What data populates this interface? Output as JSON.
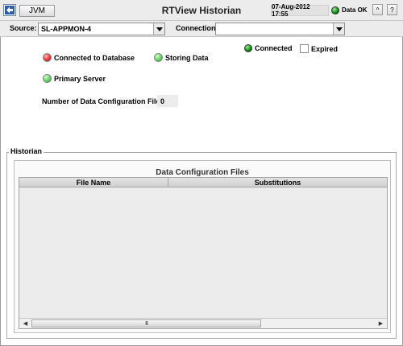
{
  "header": {
    "jvm_label": "JVM",
    "title": "RTView Historian",
    "datetime": "07-Aug-2012 17:55",
    "data_status": "Data OK",
    "up_label": "^",
    "help_label": "?"
  },
  "source_row": {
    "source_label": "Source:",
    "source_value": "SL-APPMON-4",
    "connection_label": "Connection:",
    "connection_value": ""
  },
  "status": {
    "connected_db": "Connected to Database",
    "storing_data": "Storing Data",
    "primary_server": "Primary Server",
    "legend_connected": "Connected",
    "legend_expired": "Expired",
    "num_files_label": "Number of Data Configuration Files:",
    "num_files_value": "0"
  },
  "historian": {
    "group_label": "Historian",
    "table_title": "Data Configuration Files",
    "columns": [
      "File Name",
      "Substitutions"
    ],
    "rows": [],
    "scroll_thumb": "III"
  },
  "colors": {
    "status_red": "#e33333",
    "status_green": "#5fd35f",
    "connected_green": "#139313",
    "chrome_gray": "#ececec"
  }
}
